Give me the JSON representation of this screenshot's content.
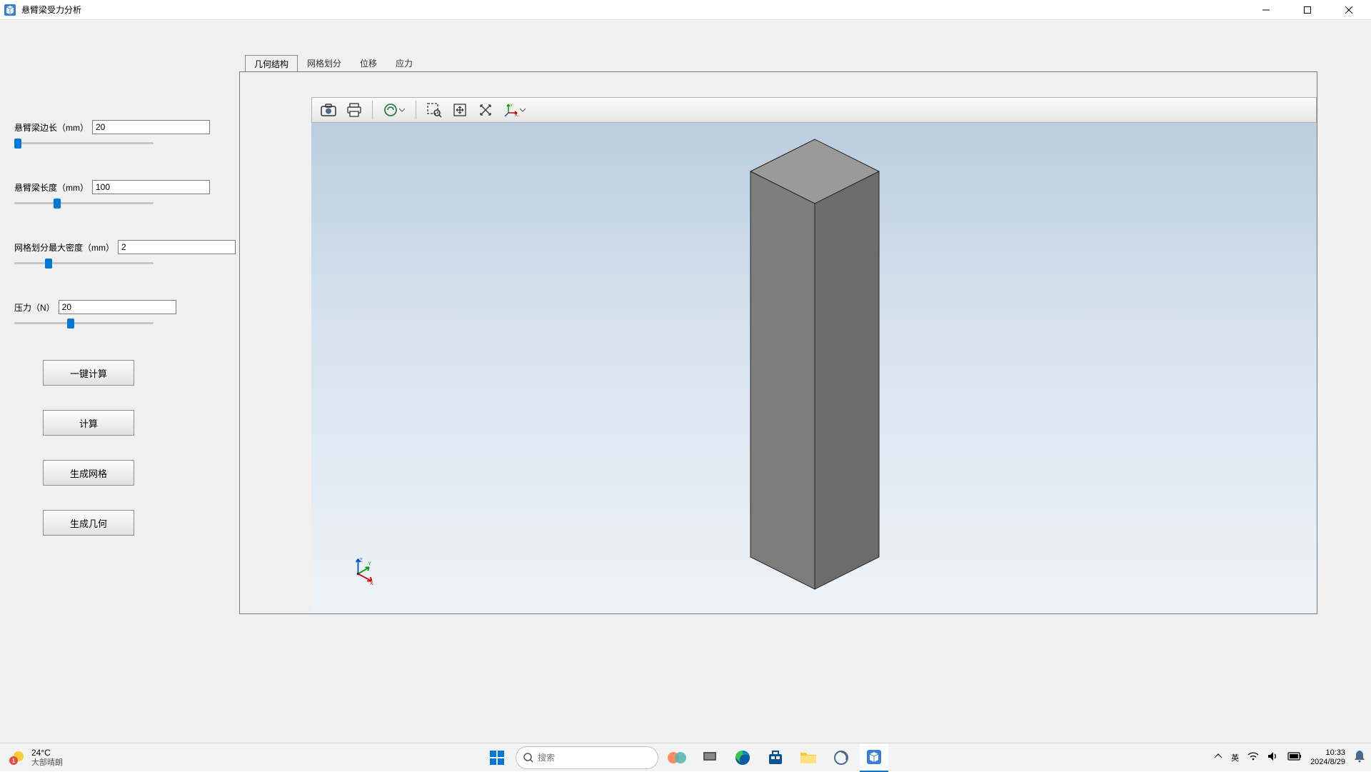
{
  "window": {
    "title": "悬臂梁受力分析"
  },
  "params": {
    "edge_label": "悬臂梁边长（mm）",
    "edge_value": "20",
    "length_label": "悬臂梁长度（mm）",
    "length_value": "100",
    "mesh_label": "网格划分最大密度（mm）",
    "mesh_value": "2",
    "force_label": "压力（N）",
    "force_value": "20"
  },
  "buttons": {
    "one_click": "一键计算",
    "compute": "计算",
    "gen_mesh": "生成网格",
    "gen_geom": "生成几何"
  },
  "tabs": {
    "geometry": "几何结构",
    "mesh": "网格划分",
    "disp": "位移",
    "stress": "应力"
  },
  "taskbar": {
    "search_placeholder": "搜索",
    "temp": "24°C",
    "weather": "大部晴朗",
    "ime": "英",
    "time": "10:33",
    "date": "2024/8/29"
  },
  "colors": {
    "accent": "#0078d7",
    "beam_light": "#9a9a9a",
    "beam_mid": "#7d7d7d",
    "beam_dark": "#6c6c6c"
  }
}
